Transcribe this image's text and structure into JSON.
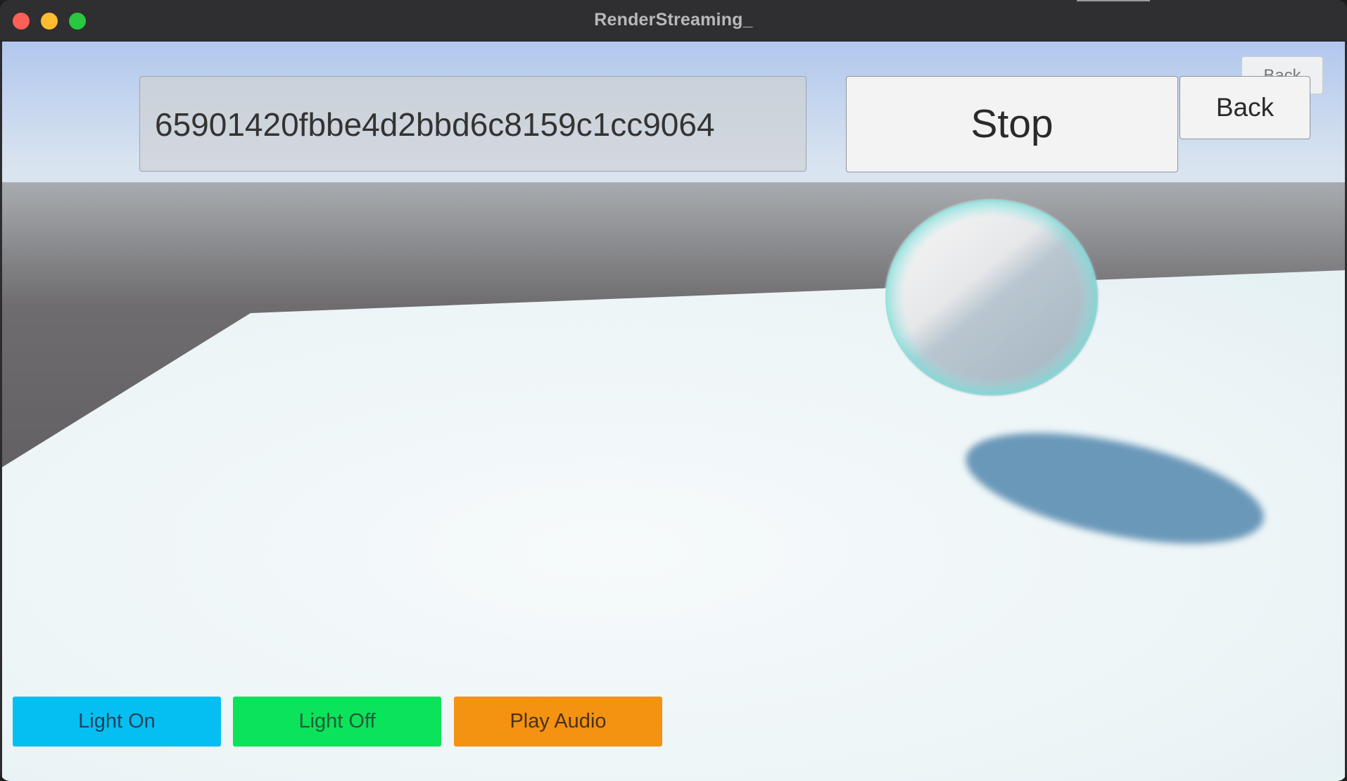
{
  "window": {
    "title": "RenderStreaming_"
  },
  "controls": {
    "connection_id": "65901420fbbe4d2bbd6c8159c1cc9064",
    "stop_label": "Stop",
    "back_label": "Back",
    "back_ghost_label": "Back"
  },
  "actions": {
    "light_on_label": "Light On",
    "light_off_label": "Light Off",
    "play_audio_label": "Play Audio"
  },
  "colors": {
    "light_on": "#06bff2",
    "light_off": "#0ae35a",
    "play_audio": "#f49211",
    "close": "#fe5f57",
    "minimize": "#febc2e",
    "maximize": "#28c840"
  }
}
